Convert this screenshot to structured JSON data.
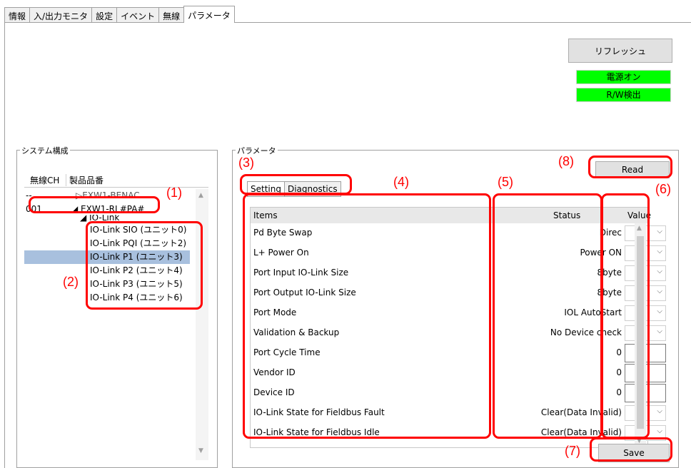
{
  "tabs": [
    {
      "label": "情報"
    },
    {
      "label": "入/出力モニタ"
    },
    {
      "label": "設定"
    },
    {
      "label": "イベント"
    },
    {
      "label": "無線"
    },
    {
      "label": "パラメータ"
    }
  ],
  "active_tab": "パラメータ",
  "top_panel": {
    "refresh_label": "リフレッシュ",
    "power_status": "電源オン",
    "rw_status": "R/W検出",
    "status_color": "#00ff00"
  },
  "system": {
    "title": "システム構成",
    "col_channel": "無線CH",
    "col_product": "製品品番",
    "rows": [
      {
        "ch": "--",
        "name": "▷EXW1-BENAC"
      },
      {
        "ch": "001",
        "name": "◢ EXW1-RL#PA#"
      },
      {
        "ch": "",
        "name": "◢ IO-Link"
      },
      {
        "ch": "",
        "name": "IO-Link SIO (ユニット0)"
      },
      {
        "ch": "",
        "name": "IO-Link PQI (ユニット2)"
      },
      {
        "ch": "",
        "name": "IO-Link P1 (ユニット3)"
      },
      {
        "ch": "",
        "name": "IO-Link P2 (ユニット4)"
      },
      {
        "ch": "",
        "name": "IO-Link P3 (ユニット5)"
      },
      {
        "ch": "",
        "name": "IO-Link P4 (ユニット6)"
      }
    ],
    "selected_row": "IO-Link P1 (ユニット3)"
  },
  "params": {
    "title": "パラメータ",
    "subtabs": [
      "Setting",
      "Diagnostics"
    ],
    "read_label": "Read",
    "save_label": "Save",
    "col_items": "Items",
    "col_status": "Status",
    "col_value": "Value",
    "rows": [
      {
        "item": "Pd Byte Swap",
        "status": "Direc",
        "value_type": "combo"
      },
      {
        "item": "L+ Power On",
        "status": "Power ON",
        "value_type": "combo"
      },
      {
        "item": "Port Input IO-Link Size",
        "status": "8byte",
        "value_type": "combo"
      },
      {
        "item": "Port Output IO-Link Size",
        "status": "8byte",
        "value_type": "combo"
      },
      {
        "item": "Port Mode",
        "status": "IOL AutoStart",
        "value_type": "combo"
      },
      {
        "item": "Validation & Backup",
        "status": "No Device check",
        "value_type": "combo"
      },
      {
        "item": "Port Cycle Time",
        "status": "0",
        "value_type": "text"
      },
      {
        "item": "Vendor ID",
        "status": "0",
        "value_type": "text"
      },
      {
        "item": "Device ID",
        "status": "0",
        "value_type": "text"
      },
      {
        "item": "IO-Link State for Fieldbus Fault",
        "status": "Clear(Data Invalid)",
        "value_type": "combo"
      },
      {
        "item": "IO-Link State for Fieldbus Idle",
        "status": "Clear(Data Invalid)",
        "value_type": "combo"
      }
    ]
  },
  "callouts": [
    "(1)",
    "(2)",
    "(3)",
    "(4)",
    "(5)",
    "(6)",
    "(7)",
    "(8)"
  ],
  "callout_color": "#ff0000",
  "icons": {
    "dropdown": "chevron-down-icon",
    "scroll_up": "scroll-up-arrow-icon",
    "scroll_down": "scroll-down-arrow-icon"
  }
}
